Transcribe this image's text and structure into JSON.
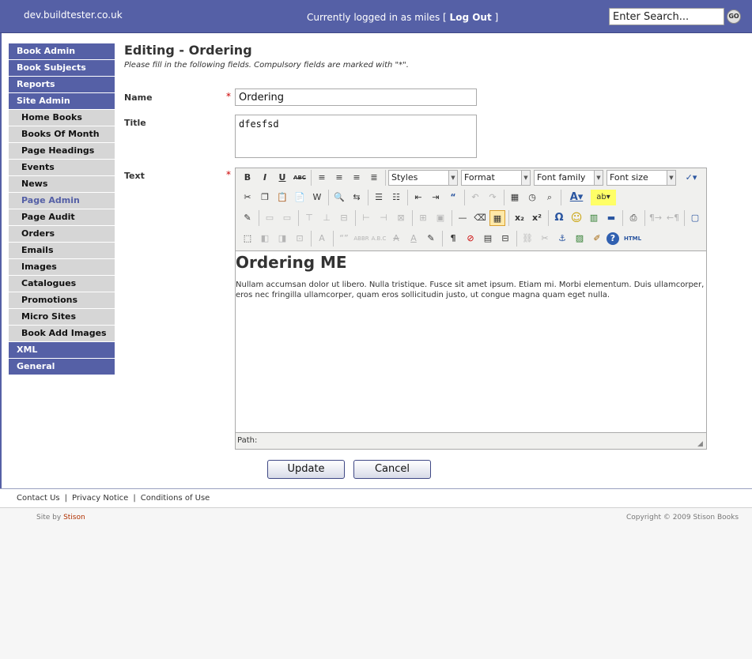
{
  "header": {
    "site_name": "dev.buildtester.co.uk",
    "login_text": "Currently logged in as miles [",
    "logout_label": "Log Out",
    "login_suffix": "]",
    "search_value": "Enter Search...",
    "go_label": "GO"
  },
  "sidebar": {
    "items": [
      {
        "label": "Book Admin",
        "type": "main"
      },
      {
        "label": "Book Subjects",
        "type": "main"
      },
      {
        "label": "Reports",
        "type": "main"
      },
      {
        "label": "Site Admin",
        "type": "main"
      },
      {
        "label": "Home Books",
        "type": "sub"
      },
      {
        "label": "Books Of Month",
        "type": "sub"
      },
      {
        "label": "Page Headings",
        "type": "sub"
      },
      {
        "label": "Events",
        "type": "sub"
      },
      {
        "label": "News",
        "type": "sub"
      },
      {
        "label": "Page Admin",
        "type": "sub",
        "active": true
      },
      {
        "label": "Page Audit",
        "type": "sub"
      },
      {
        "label": "Orders",
        "type": "sub"
      },
      {
        "label": "Emails",
        "type": "sub"
      },
      {
        "label": "Images",
        "type": "sub"
      },
      {
        "label": "Catalogues",
        "type": "sub"
      },
      {
        "label": "Promotions",
        "type": "sub"
      },
      {
        "label": "Micro Sites",
        "type": "sub"
      },
      {
        "label": "Book Add Images",
        "type": "sub"
      },
      {
        "label": "XML",
        "type": "main"
      },
      {
        "label": "General",
        "type": "main"
      }
    ]
  },
  "main": {
    "title": "Editing - Ordering",
    "instructions": "Please fill in the following fields. Compulsory fields are marked with \"*\".",
    "required_marker": "*",
    "fields": {
      "name_label": "Name",
      "name_value": "Ordering",
      "title_label": "Title",
      "title_value": "dfesfsd",
      "text_label": "Text"
    },
    "editor": {
      "styles": "Styles",
      "format": "Format",
      "font_family": "Font family",
      "font_size": "Font size",
      "content_heading": "Ordering ME",
      "content_body": "Nullam accumsan dolor ut libero. Nulla tristique. Fusce sit amet ipsum. Etiam mi. Morbi elementum. Duis ullamcorper, eros nec fringilla ullamcorper, quam eros sollicitudin justo, ut congue magna quam eget nulla.",
      "path_label": "Path:",
      "html_label": "HTML"
    },
    "buttons": {
      "update": "Update",
      "cancel": "Cancel"
    }
  },
  "footer": {
    "links": [
      "Contact Us",
      "Privacy Notice",
      "Conditions of Use"
    ],
    "separator": "|",
    "site_by_prefix": "Site by",
    "site_by_link": "Stison",
    "copyright": "Copyright © 2009 Stison Books"
  },
  "colors": {
    "brand": "#5560a6",
    "nav_sub_bg": "#d6d6d6",
    "required": "#cc0000"
  }
}
